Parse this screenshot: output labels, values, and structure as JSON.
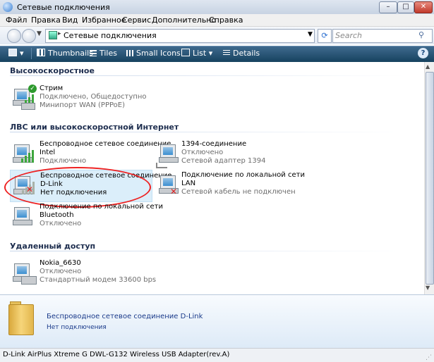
{
  "window": {
    "title": "Сетевые подключения",
    "icon": "network-connections-icon"
  },
  "menu": [
    "Файл",
    "Правка",
    "Вид",
    "Избранное",
    "Сервис",
    "Дополнительно",
    "Справка"
  ],
  "address": {
    "path": "Сетевые подключения",
    "search_placeholder": "Search"
  },
  "toolbar": {
    "thumbnails": "Thumbnails",
    "tiles": "Tiles",
    "small_icons": "Small Icons",
    "list": "List",
    "details": "Details",
    "help": "?"
  },
  "groups": [
    {
      "name": "Высокоскоростное",
      "items": [
        {
          "name": "Стрим",
          "line2": "Подключено, Общедоступно",
          "line3": "Минипорт WAN (PPPoE)"
        }
      ]
    },
    {
      "name": "ЛВС или высокоскоростной Интернет",
      "items": [
        {
          "name": "Беспроводное сетевое соединение",
          "line2": "Intel",
          "line3": "Подключено"
        },
        {
          "name": "1394-соединение",
          "line2": "Отключено",
          "line3": "Сетевой адаптер 1394"
        },
        {
          "name": "Беспроводное сетевое соединение",
          "line2": "D-Link",
          "line3": "Нет подключения"
        },
        {
          "name": "Подключение по локальной сети",
          "line2": "LAN",
          "line3": "Сетевой кабель не подключен"
        },
        {
          "name": "Подключение по локальной сети",
          "line2": "Bluetooth",
          "line3": "Отключено"
        }
      ]
    },
    {
      "name": "Удаленный доступ",
      "items": [
        {
          "name": "Nokia_6630",
          "line2": "Отключено",
          "line3": "Стандартный модем 33600 bps"
        }
      ]
    }
  ],
  "details_pane": {
    "title": "Беспроводное сетевое соединение D-Link",
    "status": "Нет подключения"
  },
  "statusbar": "D-Link AirPlus Xtreme G DWL-G132 Wireless USB Adapter(rev.A)"
}
